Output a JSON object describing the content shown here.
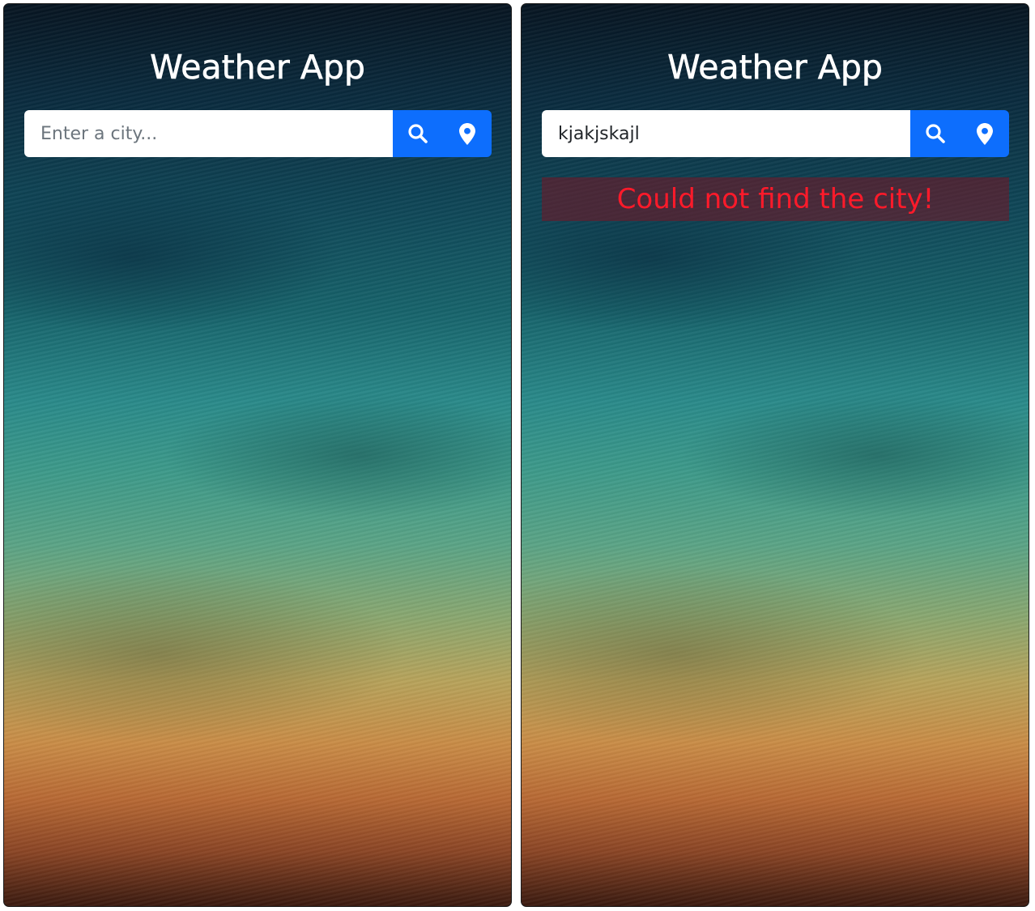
{
  "colors": {
    "accent": "#0d6efd",
    "error_text": "#ff1a2a",
    "error_background": "#7a1423"
  },
  "icons": {
    "search": "search-icon",
    "location": "map-pin-icon"
  },
  "panels": [
    {
      "title": "Weather App",
      "search": {
        "placeholder": "Enter a city...",
        "value": ""
      }
    },
    {
      "title": "Weather App",
      "search": {
        "placeholder": "Enter a city...",
        "value": "kjakjskajl"
      },
      "error": "Could not find the city!"
    }
  ]
}
